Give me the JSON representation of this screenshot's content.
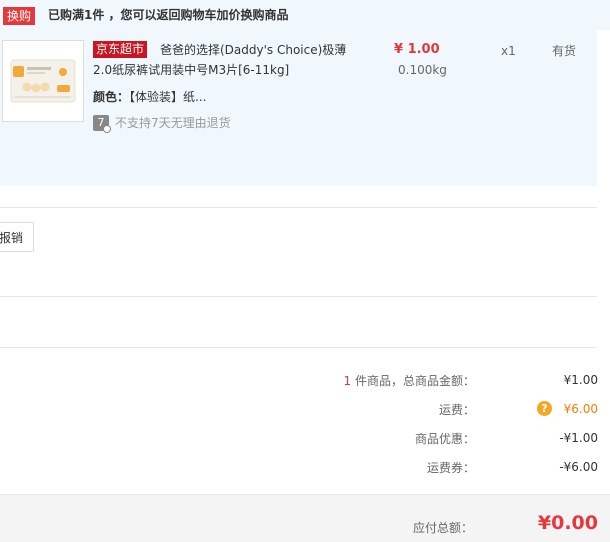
{
  "promo": {
    "tag": "换购",
    "text": "已购满1件 ，您可以返回购物车加价换购商品"
  },
  "item": {
    "shop_badge": "京东超市",
    "title_line1": "爸爸的选择(Daddy's Choice)极薄",
    "title_line2": "2.0纸尿裤试用装中号M3片[6-11kg]",
    "color_label": "颜色：",
    "color_value": "【体验装】纸...",
    "return_icon_text": "7",
    "return_policy": "不支持7天无理由退货",
    "price": "¥ 1.00",
    "weight": "0.100kg",
    "quantity": "x1",
    "stock": "有货"
  },
  "reimburse_label": "报销",
  "summary": {
    "count": "1",
    "count_label": " 件商品，总商品金额：",
    "goods_total": "¥1.00",
    "shipping_label": "运费：",
    "shipping_help_icon": "?",
    "shipping_value": "¥6.00",
    "discount_label": "商品优惠：",
    "discount_value": "-¥1.00",
    "shipping_coupon_label": "运费券：",
    "shipping_coupon_value": "-¥6.00",
    "total_label": "应付总额：",
    "total_value": "¥0.00"
  },
  "colors": {
    "accent_red": "#e4393c",
    "shop_red": "#c81623",
    "orange": "#f57e00",
    "panel_bg": "#f1f8fd"
  },
  "icons": {
    "product_image": "diaper-product-image",
    "return_policy": "no-return-icon",
    "shipping_help": "help-icon"
  }
}
